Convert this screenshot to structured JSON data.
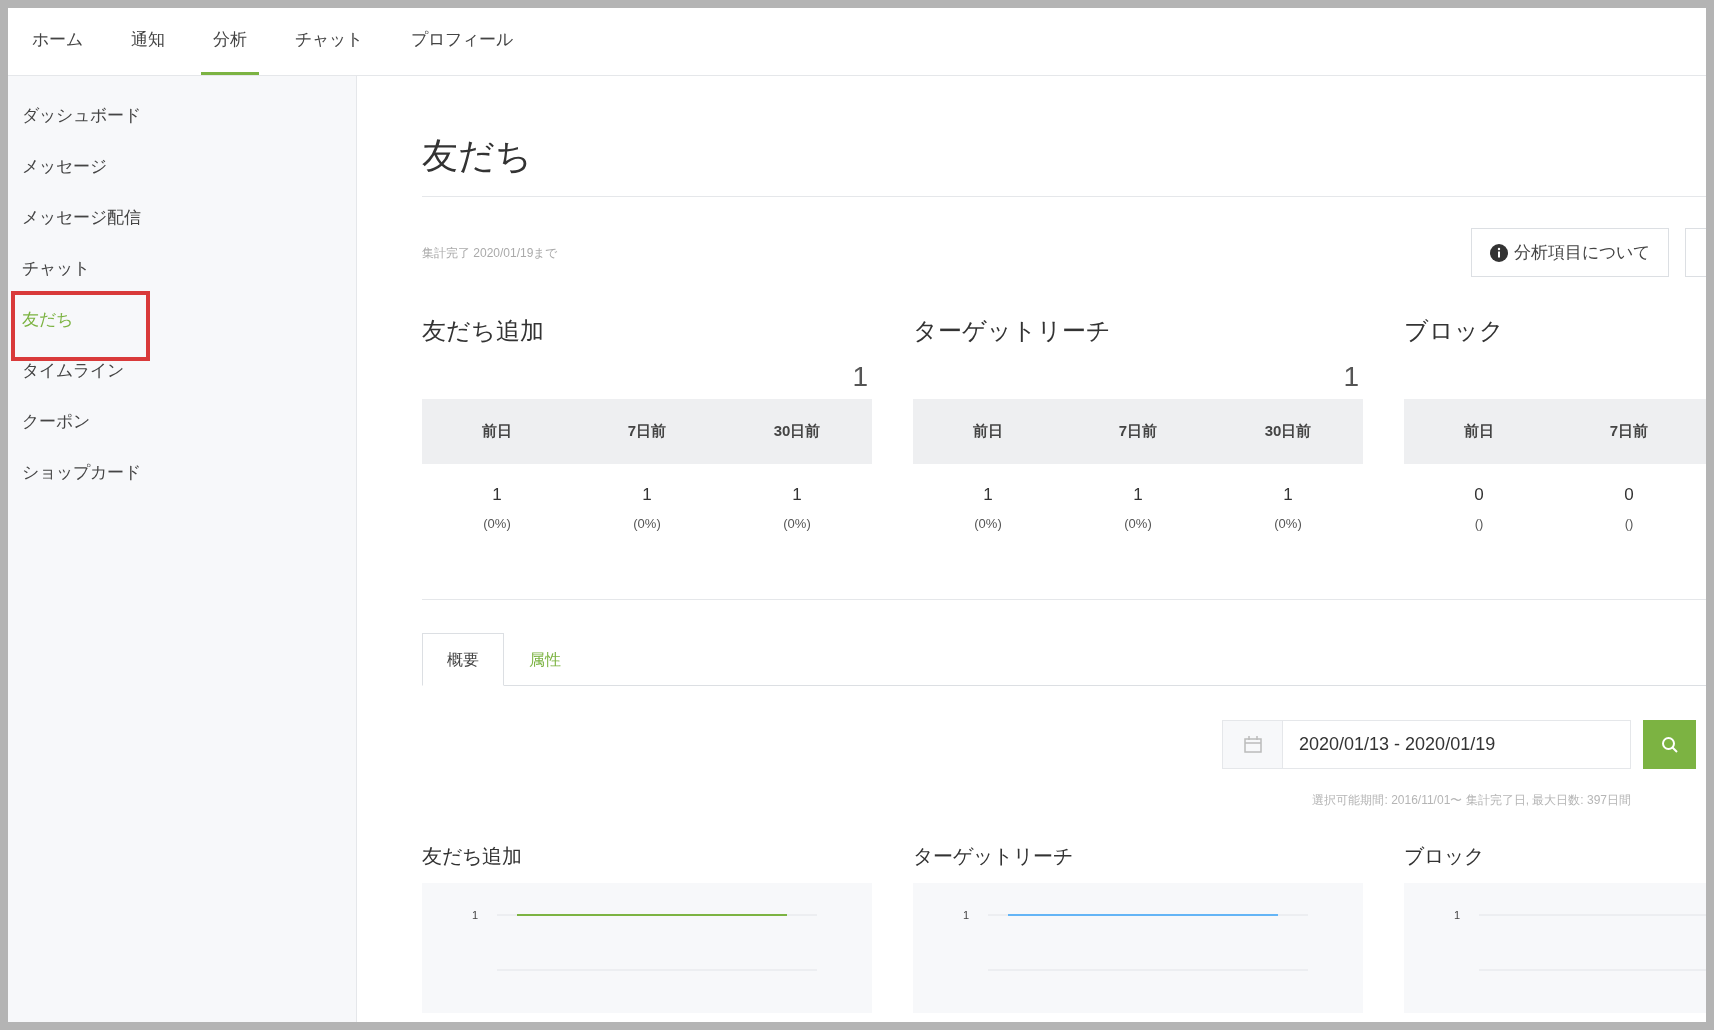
{
  "nav": {
    "tabs": [
      {
        "label": "ホーム",
        "selected": false
      },
      {
        "label": "通知",
        "selected": false
      },
      {
        "label": "分析",
        "selected": true
      },
      {
        "label": "チャット",
        "selected": false
      },
      {
        "label": "プロフィール",
        "selected": false
      }
    ]
  },
  "sidebar": {
    "items": [
      {
        "label": "ダッシュボード",
        "selected": false,
        "annotated": false
      },
      {
        "label": "メッセージ",
        "selected": false,
        "annotated": false
      },
      {
        "label": "メッセージ配信",
        "selected": false,
        "annotated": false
      },
      {
        "label": "チャット",
        "selected": false,
        "annotated": false
      },
      {
        "label": "友だち",
        "selected": true,
        "annotated": true
      },
      {
        "label": "タイムライン",
        "selected": false,
        "annotated": false
      },
      {
        "label": "クーポン",
        "selected": false,
        "annotated": false
      },
      {
        "label": "ショップカード",
        "selected": false,
        "annotated": false
      }
    ]
  },
  "page": {
    "title": "友だち",
    "note": "集計完了 2020/01/19まで",
    "about_button": "分析項目について"
  },
  "stats": [
    {
      "title": "友だち追加",
      "total": "1",
      "columns": [
        {
          "label": "前日",
          "value": "1",
          "change": "(0%)"
        },
        {
          "label": "7日前",
          "value": "1",
          "change": "(0%)"
        },
        {
          "label": "30日前",
          "value": "1",
          "change": "(0%)"
        }
      ]
    },
    {
      "title": "ターゲットリーチ",
      "total": "1",
      "columns": [
        {
          "label": "前日",
          "value": "1",
          "change": "(0%)"
        },
        {
          "label": "7日前",
          "value": "1",
          "change": "(0%)"
        },
        {
          "label": "30日前",
          "value": "1",
          "change": "(0%)"
        }
      ]
    },
    {
      "title": "ブロック",
      "columns": [
        {
          "label": "前日",
          "value": "0",
          "change": "()"
        },
        {
          "label": "7日前",
          "value": "0",
          "change": "()"
        }
      ]
    }
  ],
  "tabs": [
    {
      "label": "概要",
      "selected": true
    },
    {
      "label": "属性",
      "selected": false
    }
  ],
  "date_range": {
    "value": "2020/01/13 - 2020/01/19",
    "hint": "選択可能期間: 2016/11/01〜 集計完了日, 最大日数: 397日間"
  },
  "charts": [
    {
      "title": "友だち追加",
      "tick_label": "1",
      "color": "#7cb342"
    },
    {
      "title": "ターゲットリーチ",
      "tick_label": "1",
      "color": "#64b5f6"
    },
    {
      "title": "ブロック",
      "tick_label": "1"
    }
  ]
}
